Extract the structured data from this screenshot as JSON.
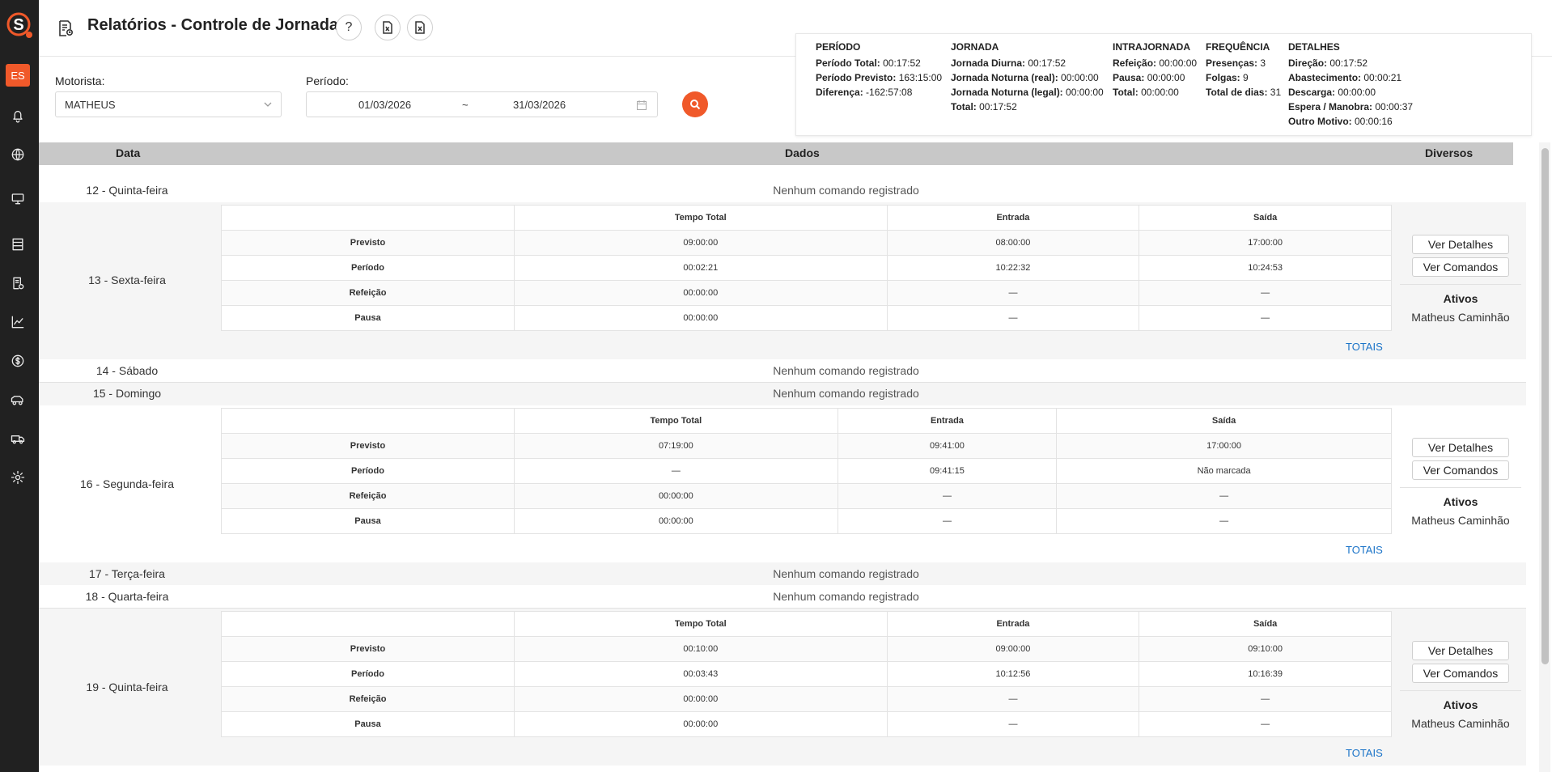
{
  "sidebar": {
    "avatar": "ES",
    "icons": [
      "bell-icon",
      "globe-icon",
      "monitor-icon",
      "list-icon",
      "report-icon",
      "chart-icon",
      "dollar-icon",
      "truck-icon",
      "fleet-icon",
      "gear-icon"
    ]
  },
  "header": {
    "title": "Relatórios - Controle de Jornada",
    "help": "?"
  },
  "summary": {
    "periodo": {
      "heading": "PERÍODO",
      "items": [
        {
          "k": "Período Total:",
          "v": " 00:17:52"
        },
        {
          "k": "Período Previsto:",
          "v": " 163:15:00"
        },
        {
          "k": "Diferença:",
          "v": " -162:57:08"
        }
      ]
    },
    "jornada": {
      "heading": "JORNADA",
      "items": [
        {
          "k": "Jornada Diurna:",
          "v": " 00:17:52"
        },
        {
          "k": "Jornada Noturna (real):",
          "v": " 00:00:00"
        },
        {
          "k": "Jornada Noturna (legal):",
          "v": " 00:00:00"
        },
        {
          "k": "Total:",
          "v": " 00:17:52"
        }
      ]
    },
    "intrajornada": {
      "heading": "INTRAJORNADA",
      "items": [
        {
          "k": "Refeição:",
          "v": " 00:00:00"
        },
        {
          "k": "Pausa:",
          "v": " 00:00:00"
        },
        {
          "k": "Total:",
          "v": " 00:00:00"
        }
      ]
    },
    "frequencia": {
      "heading": "FREQUÊNCIA",
      "items": [
        {
          "k": "Presenças:",
          "v": " 3"
        },
        {
          "k": "Folgas:",
          "v": " 9"
        },
        {
          "k": "Total de dias:",
          "v": " 31"
        }
      ]
    },
    "detalhes": {
      "heading": "DETALHES",
      "items": [
        {
          "k": "Direção:",
          "v": " 00:17:52"
        },
        {
          "k": "Abastecimento:",
          "v": " 00:00:21"
        },
        {
          "k": "Descarga:",
          "v": " 00:00:00"
        },
        {
          "k": "Espera / Manobra:",
          "v": " 00:00:37"
        },
        {
          "k": "Outro Motivo:",
          "v": " 00:00:16"
        }
      ]
    }
  },
  "filters": {
    "driver_label": "Motorista",
    "driver_value": "MATHEUS",
    "period_label": "Período",
    "start": "01/03/2026",
    "sep": "~",
    "end": "31/03/2026"
  },
  "table": {
    "col_data": "Data",
    "col_dados": "Dados",
    "col_diversos": "Diversos",
    "none_text": "Nenhum comando registrado",
    "inner_headers": [
      "Tempo Total",
      "Entrada",
      "Saída"
    ],
    "row_labels": [
      "Previsto",
      "Período",
      "Refeição",
      "Pausa"
    ],
    "btn_detalhes": "Ver Detalhes",
    "btn_comandos": "Ver Comandos",
    "ativos_label": "Ativos",
    "ativos_value": "Matheus Caminhão",
    "totais": "TOTAIS",
    "days": [
      {
        "date": "12 - Quinta-feira"
      },
      {
        "date": "13 - Sexta-feira",
        "rows": [
          [
            "09:00:00",
            "08:00:00",
            "17:00:00"
          ],
          [
            "00:02:21",
            "10:22:32",
            "10:24:53"
          ],
          [
            "00:00:00",
            "—",
            "—"
          ],
          [
            "00:00:00",
            "—",
            "—"
          ]
        ]
      },
      {
        "date": "14 - Sábado"
      },
      {
        "date": "15 - Domingo"
      },
      {
        "date": "16 - Segunda-feira",
        "rows": [
          [
            "07:19:00",
            "09:41:00",
            "17:00:00"
          ],
          [
            "—",
            "09:41:15",
            "Não marcada"
          ],
          [
            "00:00:00",
            "—",
            "—"
          ],
          [
            "00:00:00",
            "—",
            "—"
          ]
        ]
      },
      {
        "date": "17 - Terça-feira"
      },
      {
        "date": "18 - Quarta-feira"
      },
      {
        "date": "19 - Quinta-feira",
        "rows": [
          [
            "00:10:00",
            "09:00:00",
            "09:10:00"
          ],
          [
            "00:03:43",
            "10:12:56",
            "10:16:39"
          ],
          [
            "00:00:00",
            "—",
            "—"
          ],
          [
            "00:00:00",
            "—",
            "—"
          ]
        ]
      }
    ]
  }
}
